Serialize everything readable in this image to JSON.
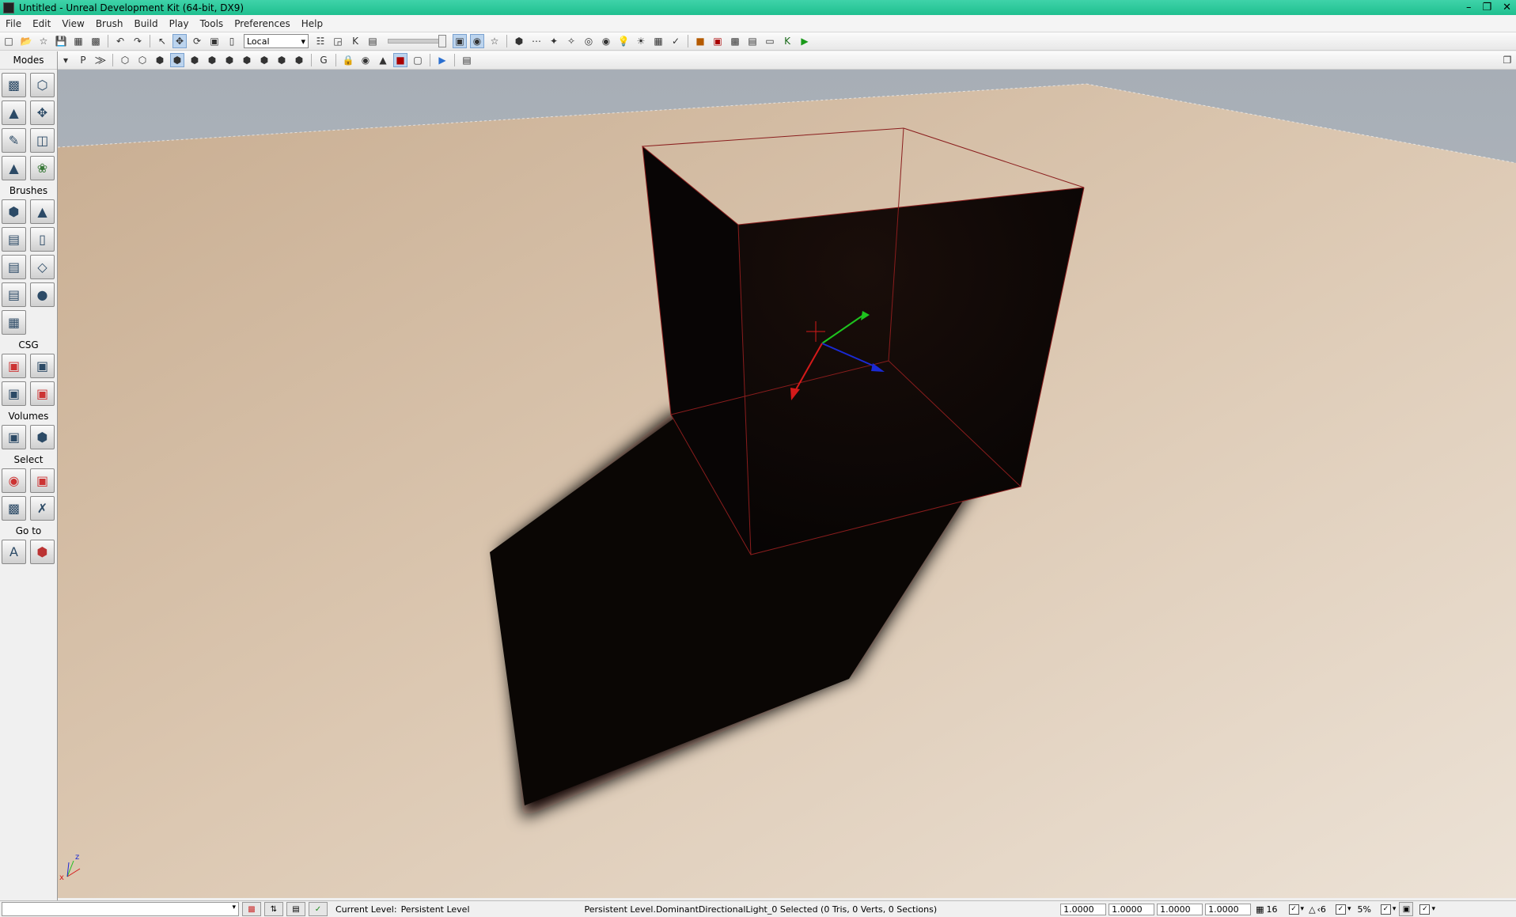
{
  "window": {
    "title": "Untitled - Unreal Development Kit (64-bit, DX9)"
  },
  "menu": [
    "File",
    "Edit",
    "View",
    "Brush",
    "Build",
    "Play",
    "Tools",
    "Preferences",
    "Help"
  ],
  "toolbar": {
    "coordinate_system": "Local"
  },
  "modes_panel": {
    "header": "Modes",
    "sections": {
      "brushes": "Brushes",
      "csg": "CSG",
      "volumes": "Volumes",
      "select": "Select",
      "goto": "Go to"
    }
  },
  "statusbar": {
    "current_level_label": "Current Level:",
    "current_level": "Persistent Level",
    "selection_info": "Persistent Level.DominantDirectionalLight_0 Selected (0 Tris, 0 Verts, 0 Sections)",
    "drag_values": [
      "1.0000",
      "1.0000",
      "1.0000",
      "1.0000"
    ],
    "grid_size": "16",
    "rotation_snap": "‹6",
    "scale_snap": "5%"
  },
  "colors": {
    "title_bar": "#1fbf8f",
    "floor": "#d8c5af",
    "sky": "#b5bbc1",
    "box": "#0b0706",
    "box_edge": "#8a1d1d"
  }
}
